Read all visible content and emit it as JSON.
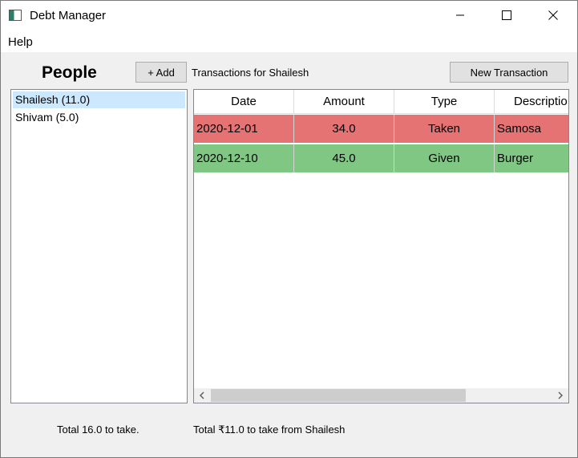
{
  "window": {
    "title": "Debt Manager",
    "minimize_icon": "minimize-icon",
    "maximize_icon": "maximize-icon",
    "close_icon": "close-icon"
  },
  "menubar": {
    "items": [
      {
        "label": "Help"
      }
    ]
  },
  "people_panel": {
    "title": "People",
    "add_button_label": "+ Add",
    "people": [
      {
        "label": "Shailesh  (11.0)",
        "selected": true
      },
      {
        "label": "Shivam  (5.0)",
        "selected": false
      }
    ]
  },
  "transactions_panel": {
    "title": "Transactions for Shailesh",
    "new_button_label": "New Transaction",
    "columns": [
      "Date",
      "Amount",
      "Type",
      "Descriptio"
    ],
    "rows": [
      {
        "date": "2020-12-01",
        "amount": "34.0",
        "type": "Taken",
        "description": "Samosa",
        "color": "#e57373"
      },
      {
        "date": "2020-12-10",
        "amount": "45.0",
        "type": "Given",
        "description": "Burger",
        "color": "#81c784"
      }
    ]
  },
  "footer": {
    "total_left": "Total 16.0 to take.",
    "total_right": "Total ₹11.0 to take from Shailesh"
  },
  "colors": {
    "selection": "#cce8ff",
    "taken_row": "#e57373",
    "given_row": "#81c784"
  }
}
